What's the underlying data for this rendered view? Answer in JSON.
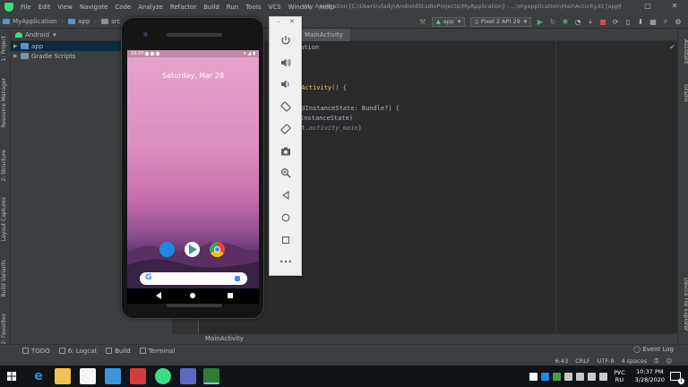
{
  "menu": [
    "File",
    "Edit",
    "View",
    "Navigate",
    "Code",
    "Analyze",
    "Refactor",
    "Build",
    "Run",
    "Tools",
    "VCS",
    "Window",
    "Help"
  ],
  "window_title": "My Application [C:\\Users\\vlady\\AndroidStudioProjects\\MyApplication] - ...\\myapplication\\MainActivity.kt [app]",
  "window_controls": {
    "minimize": "–",
    "maximize": "□",
    "close": "✕"
  },
  "breadcrumbs": [
    "MyApplication",
    "app",
    "src",
    "m"
  ],
  "toolbar": {
    "run_config": "app",
    "device": "Pixel 2 API 29"
  },
  "left_tool_tabs": [
    "1: Project",
    "Resource Manager",
    "2: Structure",
    "Layout Captures",
    "Build Variants",
    "2: Favorites"
  ],
  "right_tool_tabs": [
    "Assistant",
    "Gradle",
    "Device File Explorer"
  ],
  "project_panel": {
    "view_mode": "Android",
    "items": [
      {
        "label": "app",
        "selected": true,
        "icon": "module-folder-icon"
      },
      {
        "label": "Gradle Scripts",
        "selected": false,
        "icon": "gradle-scripts-icon"
      }
    ]
  },
  "editor": {
    "tab_label": "MainActivity",
    "code": [
      {
        "pre": "ation",
        "kw": "",
        "fn": "",
        "post": "",
        "it": "",
        "end": ""
      },
      {
        "pre": "",
        "kw": "",
        "fn": "atActivity",
        "post": "() {",
        "it": "",
        "end": ""
      },
      {
        "pre": "vedInstanceState: Bundle?) {",
        "kw": "",
        "fn": "",
        "post": "",
        "it": "",
        "end": ""
      },
      {
        "pre": "InstanceState)",
        "kw": "",
        "fn": "",
        "post": "",
        "it": "",
        "end": ""
      },
      {
        "pre": "out.",
        "kw": "",
        "fn": "",
        "post": "",
        "it": "activity_main",
        "end": ")"
      }
    ],
    "breadcrumb": "MainActivity"
  },
  "bottom_tools": [
    "TODO",
    "6: Logcat",
    "Build",
    "Terminal"
  ],
  "event_log": "Event Log",
  "status_bar": [
    "6:43",
    "CRLF",
    "UTF-8",
    "4 spaces"
  ],
  "emulator": {
    "status_time": "10:37",
    "date": "Saturday, Mar 28",
    "search_logo": "G",
    "toolbar_buttons": [
      "power-icon",
      "volume-up-icon",
      "volume-down-icon",
      "rotate-left-icon",
      "rotate-right-icon",
      "screenshot-icon",
      "zoom-icon",
      "back-icon",
      "home-icon",
      "overview-icon",
      "more-icon"
    ],
    "header_controls": {
      "minimize": "–",
      "close": "✕"
    },
    "more_label": "•••"
  },
  "taskbar": {
    "lang": "РУС",
    "lang2": "RU",
    "time": "10:37 PM",
    "date": "3/28/2020",
    "notifications": "1"
  },
  "colors": {
    "ide_bg": "#2b2b2b",
    "panel": "#3c3f41",
    "accent_green": "#3ddc84",
    "selection": "#0d293e"
  }
}
